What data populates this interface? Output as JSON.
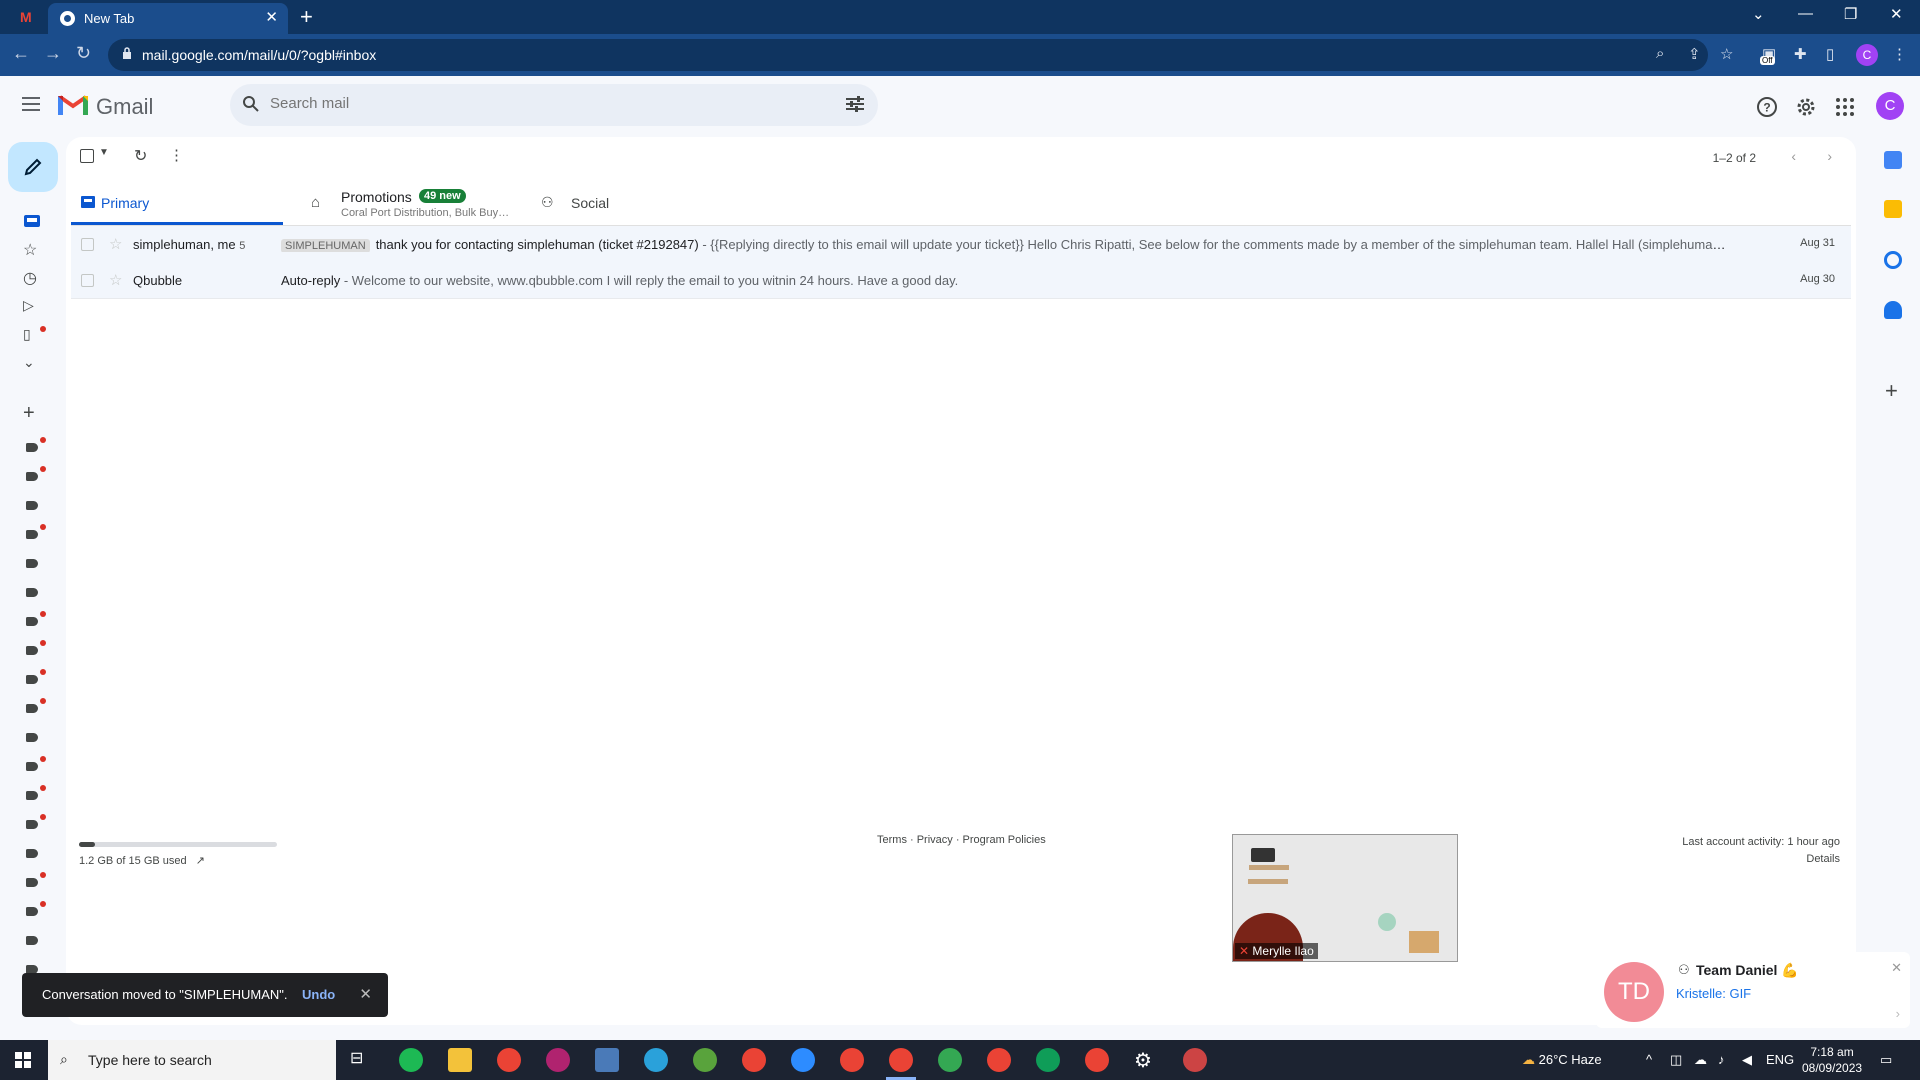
{
  "browser": {
    "tab_title": "New Tab",
    "new_tab_symbol": "+",
    "url": "mail.google.com/mail/u/0/?ogbl#inbox",
    "profile_initial": "C",
    "extension_badge": "Off"
  },
  "gmail": {
    "app_name": "Gmail",
    "search_placeholder": "Search mail",
    "account_initial": "C"
  },
  "toolbar": {
    "pager": "1–2 of 2"
  },
  "tabs": [
    {
      "label": "Primary"
    },
    {
      "label": "Promotions",
      "badge": "49 new",
      "subtitle": "Coral Port Distribution, Bulk Buy…"
    },
    {
      "label": "Social"
    }
  ],
  "emails": [
    {
      "sender": "simplehuman, me",
      "count": "5",
      "label": "SIMPLEHUMAN",
      "subject": "thank you for contacting simplehuman (ticket #2192847)",
      "snippet": " - {{Replying directly to this email will update your ticket}} Hello Chris Ripatti, See below for the comments made by a member of the simplehuman team. Hallel Hall (simplehuman) A...",
      "date": "Aug 31"
    },
    {
      "sender": "Qbubble",
      "count": "",
      "label": "",
      "subject": "Auto-reply",
      "snippet": " - Welcome to our website, www.qbubble.com I will reply the email to you witnin 24 hours. Have a good day.",
      "date": "Aug 30"
    }
  ],
  "footer": {
    "storage_text": "1.2 GB of 15 GB used",
    "storage_fraction": 0.08,
    "links": "Terms · Privacy · Program Policies",
    "last_activity": "Last account activity: 1 hour ago",
    "details": "Details"
  },
  "video": {
    "participant": "Merylle Ilao"
  },
  "snackbar": {
    "message": "Conversation moved to \"SIMPLEHUMAN\".",
    "action": "Undo"
  },
  "chat": {
    "avatar_initials": "TD",
    "name": "Team Daniel 💪",
    "message": "Kristelle: GIF"
  },
  "taskbar": {
    "search_placeholder": "Type here to search",
    "weather": "26°C  Haze",
    "lang": "ENG",
    "time": "7:18 am",
    "date": "08/09/2023"
  },
  "colors": {
    "accent": "#0b57d0",
    "browser_frame": "#0f3460",
    "badge_green": "#188038",
    "unread_dot": "#d93025"
  }
}
